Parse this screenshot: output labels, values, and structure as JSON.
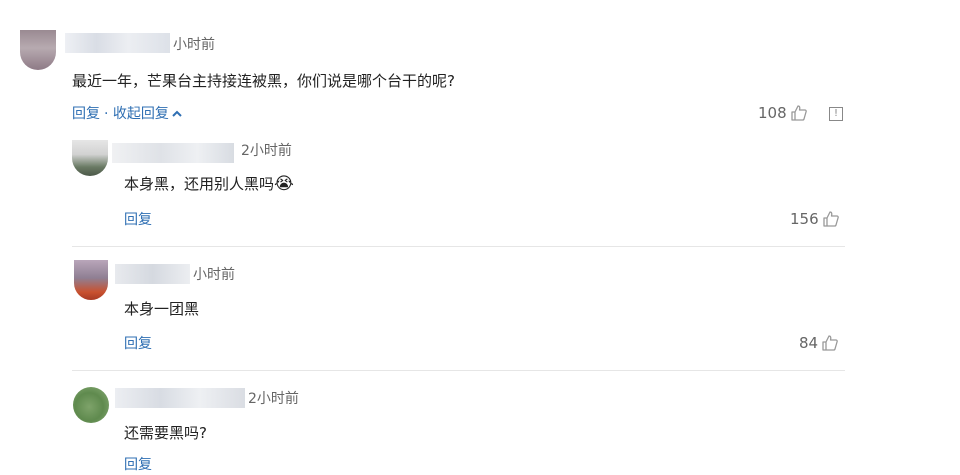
{
  "comments": [
    {
      "time": "小时前",
      "text": "最近一年，芒果台主持接连被黑，你们说是哪个台干的呢?",
      "reply_label": "回复",
      "collapse_label": "· 收起回复",
      "likes": "108"
    }
  ],
  "replies": [
    {
      "time": "2小时前",
      "text": "本身黑，还用别人黑吗",
      "emoji": "😭",
      "reply_label": "回复",
      "likes": "156"
    },
    {
      "time": "小时前",
      "text": "本身一团黑",
      "reply_label": "回复",
      "likes": "84"
    },
    {
      "time": "2小时前",
      "text": "还需要黑吗?",
      "reply_label": "回复"
    }
  ],
  "icons": {
    "like": "thumbs-up-icon",
    "report": "report-icon",
    "collapse": "chevron-up-icon"
  },
  "colors": {
    "link": "#2f6fb3",
    "text": "#222222",
    "muted": "#666666"
  }
}
